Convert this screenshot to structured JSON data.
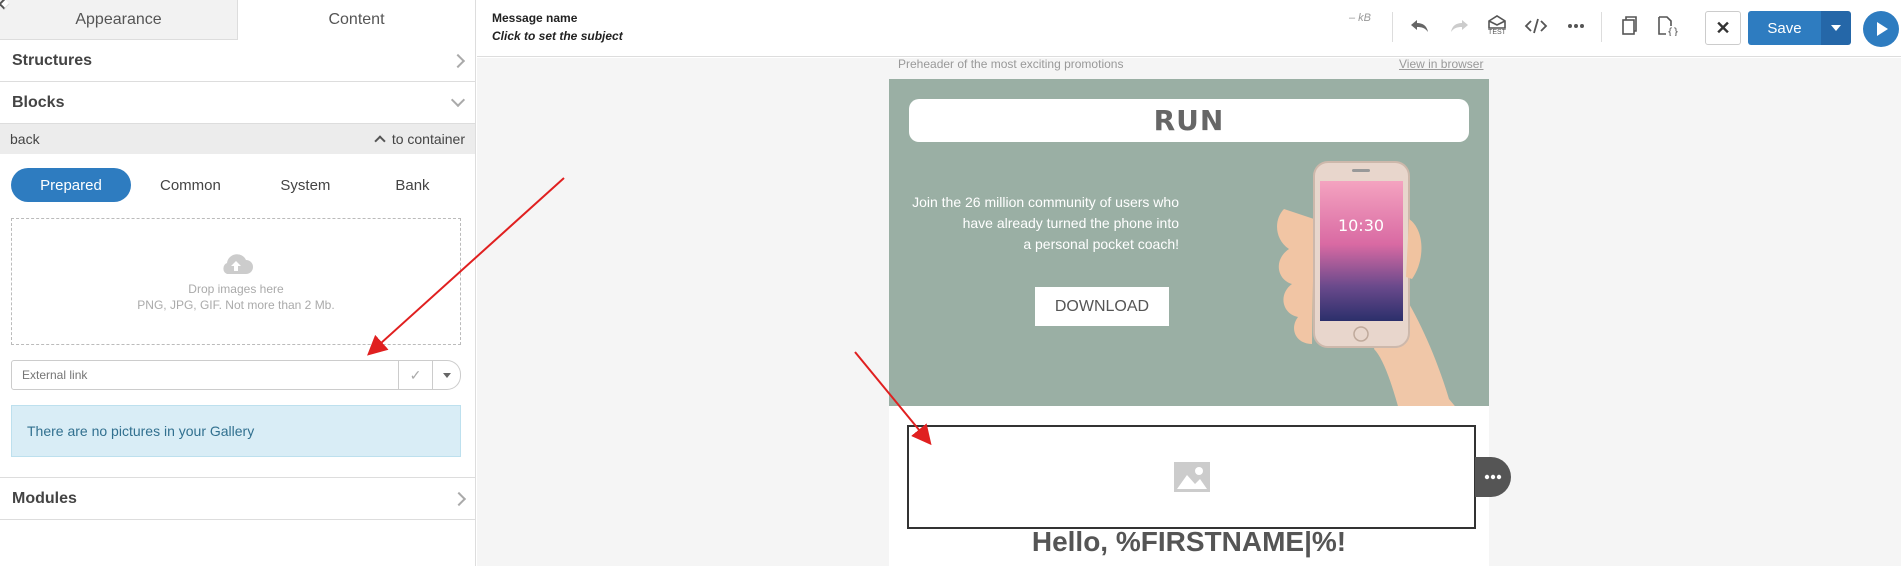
{
  "left_panel": {
    "tabs": [
      {
        "label": "Appearance",
        "active": false
      },
      {
        "label": "Content",
        "active": true
      }
    ],
    "sections": {
      "structures": "Structures",
      "blocks": "Blocks",
      "modules": "Modules"
    },
    "nav": {
      "back": "back",
      "to_container": "to container"
    },
    "block_tabs": [
      {
        "label": "Prepared",
        "active": true
      },
      {
        "label": "Common",
        "active": false
      },
      {
        "label": "System",
        "active": false
      },
      {
        "label": "Bank",
        "active": false
      }
    ],
    "dropzone": {
      "icon": "cloud-upload-icon",
      "line1": "Drop images here",
      "line2": "PNG, JPG, GIF. Not more than 2 Mb."
    },
    "external_link": {
      "placeholder": "External link",
      "value": ""
    },
    "gallery_message": "There are no pictures in your Gallery"
  },
  "topbar": {
    "message_name": "Message name",
    "subject_hint": "Click to set the subject",
    "size": "– kB",
    "test_label": "TEST",
    "save_label": "Save",
    "colors": {
      "primary": "#2e7cc0"
    }
  },
  "email": {
    "preheader": "Preheader of the most exciting promotions",
    "view_in_browser": "View in browser",
    "logo_text": "RUN",
    "hero_text_lines": [
      "Join the 26 million community of users who",
      "have already turned the phone into",
      "a personal pocket coach!"
    ],
    "download_button": "DOWNLOAD",
    "phone_time": "10:30",
    "greeting": "Hello, %FIRSTNAME|%!",
    "hero_bg": "#9aafa4"
  }
}
